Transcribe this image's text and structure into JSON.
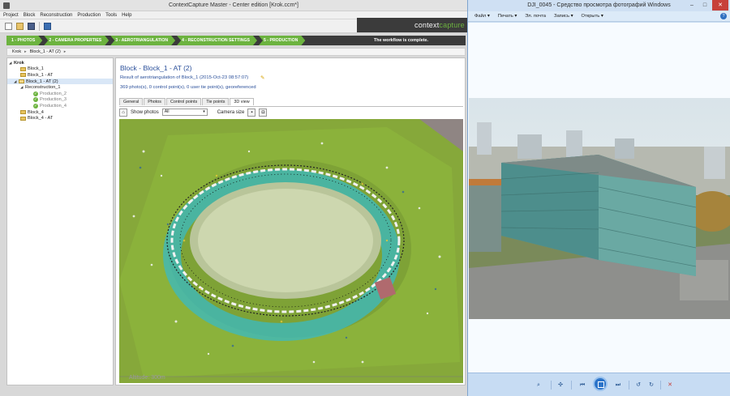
{
  "cc": {
    "title": "ContextCapture Master - Center edition [Krok.ccm*]",
    "menu": [
      "Project",
      "Block",
      "Reconstruction",
      "Production",
      "Tools",
      "Help"
    ],
    "brand_main": "context",
    "brand_accent": "capture",
    "workflow_steps": [
      "1 - PHOTOS",
      "2 - CAMERA PROPERTIES",
      "3 - AEROTRIANGULATION",
      "4 - RECONSTRUCTION SETTINGS",
      "5 - PRODUCTION"
    ],
    "workflow_status": "The workflow is complete.",
    "breadcrumb": [
      "Krok",
      "Block_1 - AT (2)"
    ],
    "tree": [
      {
        "label": "Krok"
      },
      {
        "label": "Block_1"
      },
      {
        "label": "Block_1 - AT"
      },
      {
        "label": "Block_1 - AT (2)"
      },
      {
        "label": "Reconstruction_1"
      },
      {
        "label": "Production_2"
      },
      {
        "label": "Production_3"
      },
      {
        "label": "Production_4"
      },
      {
        "label": "Block_4"
      },
      {
        "label": "Block_4 - AT"
      }
    ],
    "heading": "Block - Block_1 - AT (2)",
    "result": "Result of aerotriangulation of Block_1 (2015-Oct-23 08:57:07)",
    "summary": "369 photo(s), 0 control point(s), 0 user tie point(s), georeferenced",
    "tabs": [
      "General",
      "Photos",
      "Control points",
      "Tie points",
      "3D view"
    ],
    "active_tab": "3D view",
    "show_photos_label": "Show photos",
    "show_photos_value": "All",
    "camera_size_label": "Camera size",
    "altitude": "Altitude: 300m",
    "colors": {
      "accent_green": "#6cb33f",
      "title_blue": "#2a4f9a",
      "workflow_bg": "#3b3b3b"
    }
  },
  "wpv": {
    "title": "DJI_0045 - Средство просмотра фотографий Windows",
    "menu": [
      "Файл ▾",
      "Печать ▾",
      "Эл. почта",
      "Запись ▾",
      "Открыть ▾"
    ],
    "help": "?",
    "window_controls": {
      "minimize": "–",
      "maximize": "□",
      "close": "✕"
    },
    "bottom_icons": [
      "zoom-icon",
      "fit-icon",
      "previous-icon",
      "slideshow-icon",
      "next-icon",
      "rotate-left-icon",
      "rotate-right-icon",
      "delete-icon"
    ]
  }
}
